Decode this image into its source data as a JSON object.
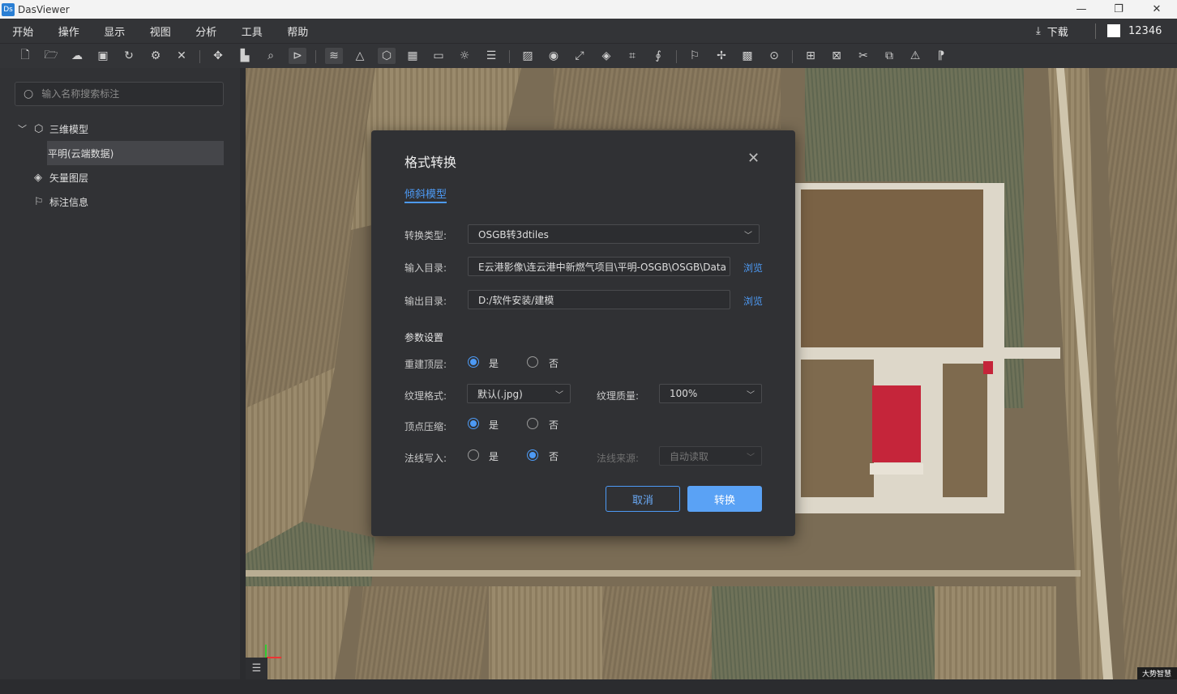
{
  "window": {
    "app_icon": "Ds",
    "title": "DasViewer"
  },
  "menu": [
    "开始",
    "操作",
    "显示",
    "视图",
    "分析",
    "工具",
    "帮助"
  ],
  "header": {
    "download_label": "下载",
    "user_id": "12346"
  },
  "sidebar": {
    "search_placeholder": "输入名称搜索标注",
    "tree": {
      "root_label": "三维模型",
      "child_label": "平明(云端数据)",
      "vector_label": "矢量图层",
      "annotation_label": "标注信息"
    }
  },
  "dialog": {
    "title": "格式转换",
    "tab": "倾斜模型",
    "convert_type_label": "转换类型:",
    "convert_type_value": "OSGB转3dtiles",
    "input_dir_label": "输入目录:",
    "input_dir_value": "E云港影像\\连云港中新燃气项目\\平明-OSGB\\OSGB\\Data",
    "output_dir_label": "输出目录:",
    "output_dir_value": "D:/软件安装/建模",
    "browse_label": "浏览",
    "params_title": "参数设置",
    "rebuild_top_label": "重建顶层:",
    "texture_format_label": "纹理格式:",
    "texture_format_value": "默认(.jpg)",
    "texture_quality_label": "纹理质量:",
    "texture_quality_value": "100%",
    "vertex_compress_label": "顶点压缩:",
    "normal_write_label": "法线写入:",
    "normal_source_label": "法线来源:",
    "normal_source_value": "自动读取",
    "yes_label": "是",
    "no_label": "否",
    "cancel_label": "取消",
    "convert_label": "转换"
  },
  "viewport": {
    "watermark": "大势智慧"
  }
}
